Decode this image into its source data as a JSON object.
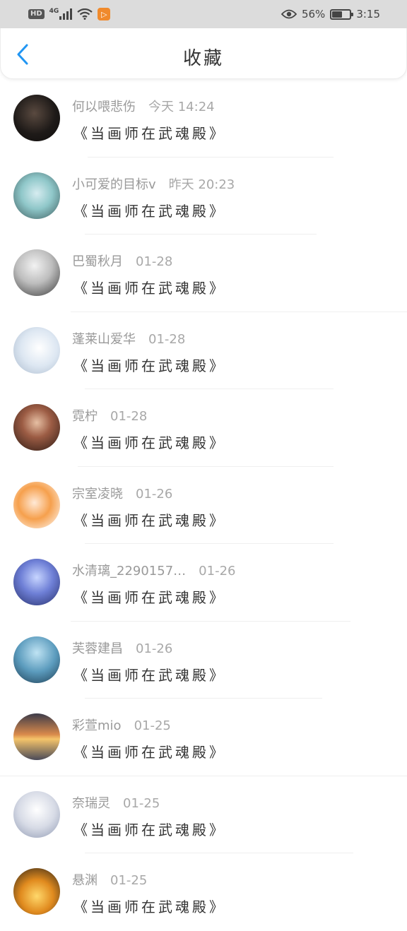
{
  "status_bar": {
    "hd": "HD",
    "network": "4G",
    "notif_glyph": "▷",
    "battery": "56%",
    "battery_level": 0.56,
    "time": "3:15"
  },
  "header": {
    "title": "收藏",
    "back_icon": "chevron-left-icon",
    "accent": "#2196f3"
  },
  "favorites": [
    {
      "name": "何以喂悲伤",
      "time": "今天 14:24",
      "title": "《当画师在武魂殿》"
    },
    {
      "name": "小可爱的目标v",
      "time": "昨天 20:23",
      "title": "《当画师在武魂殿》"
    },
    {
      "name": "巴蜀秋月",
      "time": "01-28",
      "title": "《当画师在武魂殿》"
    },
    {
      "name": "蓬莱山爱华",
      "time": "01-28",
      "title": "《当画师在武魂殿》"
    },
    {
      "name": "霓柠",
      "time": "01-28",
      "title": "《当画师在武魂殿》"
    },
    {
      "name": "宗室凌晓",
      "time": "01-26",
      "title": "《当画师在武魂殿》"
    },
    {
      "name": "水清璃_2290157…",
      "time": "01-26",
      "title": "《当画师在武魂殿》"
    },
    {
      "name": "芙蓉建昌",
      "time": "01-26",
      "title": "《当画师在武魂殿》"
    },
    {
      "name": "彩萱mio",
      "time": "01-25",
      "title": "《当画师在武魂殿》"
    },
    {
      "name": "奈瑞灵",
      "time": "01-25",
      "title": "《当画师在武魂殿》"
    },
    {
      "name": "悬渊",
      "time": "01-25",
      "title": "《当画师在武魂殿》"
    }
  ]
}
